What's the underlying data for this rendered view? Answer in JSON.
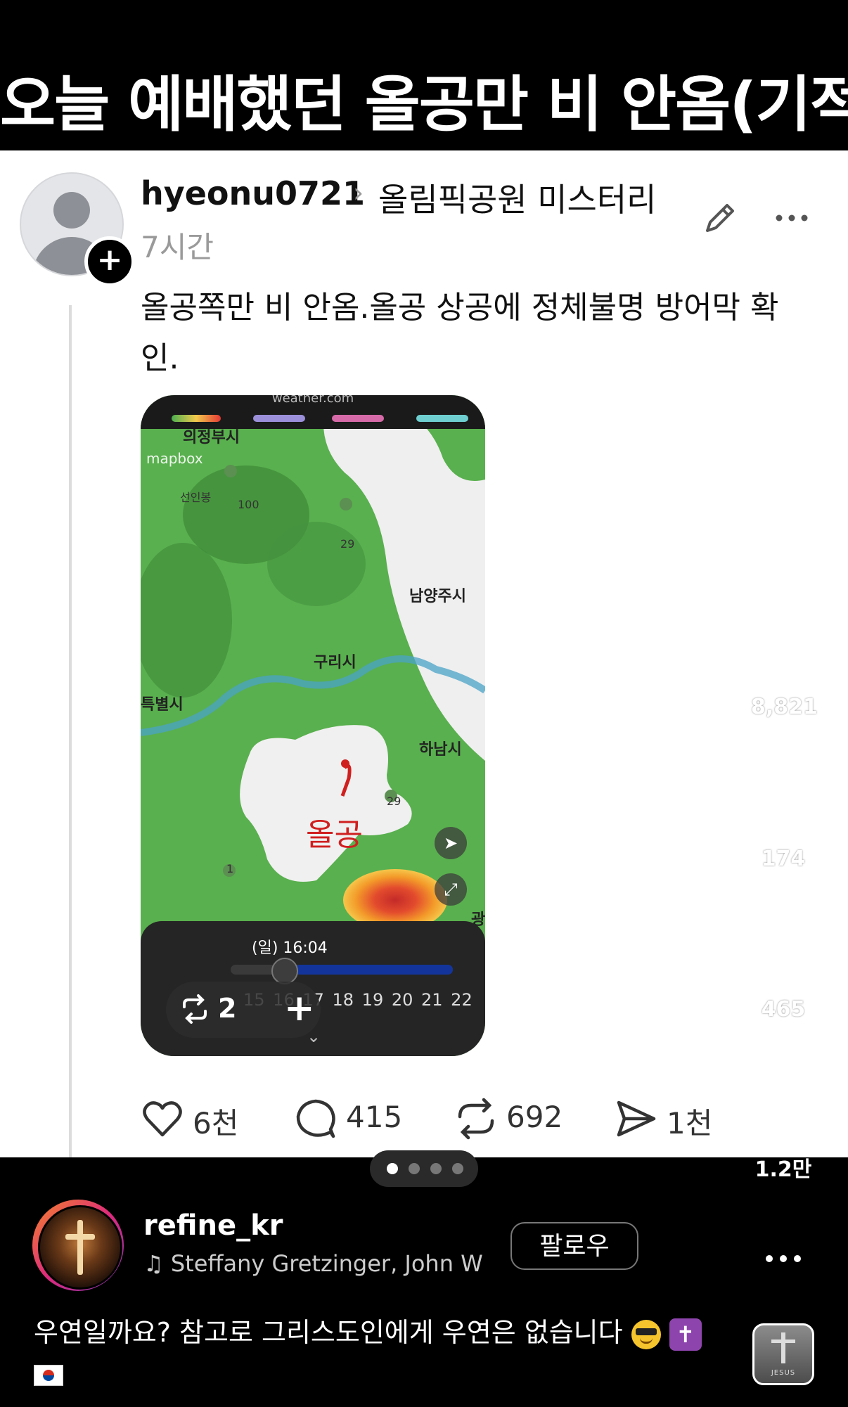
{
  "banner": {
    "title": "오늘 예배했던 올공만 비 안옴(기적)"
  },
  "post": {
    "username": "hyeonu0721",
    "community": "올림픽공원 미스터리",
    "time": "7시간",
    "text": "올공쪽만 비 안옴.올공 상공에 정체불명 방어막 확인.",
    "embedded_image": {
      "source_watermark": "weather.com",
      "mapbox_label": "mapbox",
      "map_labels": [
        "의정부시",
        "선인봉",
        "남양주시",
        "구리시",
        "특별시",
        "하남시",
        "광"
      ],
      "road_labels": [
        "100",
        "29",
        "29",
        "1"
      ],
      "handwritten_label": "올공",
      "timeline_date": "(일) 16:04",
      "timeline_hours": "15 16 17 18 19 20 21 22",
      "overlay_count": "2"
    },
    "actions": {
      "likes": "6천",
      "comments": "415",
      "reposts": "692",
      "shares": "1천"
    }
  },
  "reel": {
    "likes": "8,821",
    "comments": "174",
    "reposts": "465",
    "shares": "1.2만",
    "creator": "refine_kr",
    "music": "Steffany Gretzinger, John W",
    "follow_label": "팔로우",
    "caption": "우연일까요? 참고로 그리스도인에게 우연은 없습니다",
    "audio_thumb_label": "JESUS",
    "page_count": 4,
    "active_page": 1
  },
  "colors": {
    "map_green": "#59b04e",
    "accent_radar_red": "#e0382a",
    "timeline_blue": "#13359b",
    "follow_border": "#777777"
  }
}
